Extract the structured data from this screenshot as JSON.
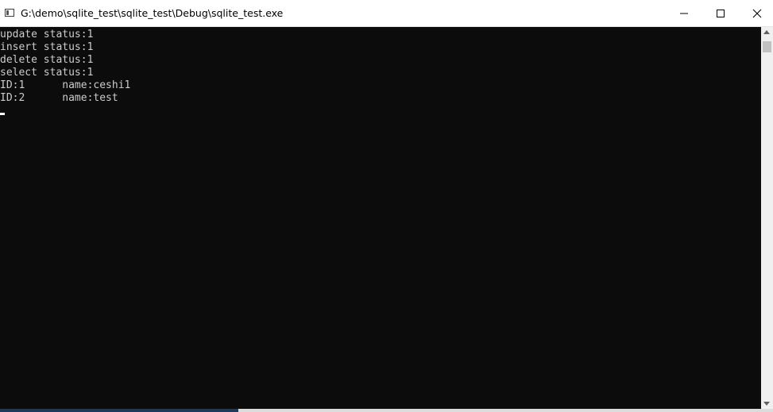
{
  "window": {
    "title": "G:\\demo\\sqlite_test\\sqlite_test\\Debug\\sqlite_test.exe"
  },
  "console": {
    "lines": [
      "update status:1",
      "insert status:1",
      "delete status:1",
      "select status:1",
      "ID:1      name:ceshi1",
      "ID:2      name:test"
    ]
  },
  "icons": {
    "app": "console-app-icon",
    "minimize": "minimize-icon",
    "maximize": "maximize-icon",
    "close": "close-icon",
    "scroll_up": "scroll-up-arrow-icon",
    "scroll_down": "scroll-down-arrow-icon"
  },
  "colors": {
    "console_background": "#0c0c0c",
    "console_text": "#cccccc",
    "titlebar_background": "#ffffff",
    "scrollbar_track": "#f0f0f0",
    "scrollbar_thumb": "#c1c1c1"
  }
}
